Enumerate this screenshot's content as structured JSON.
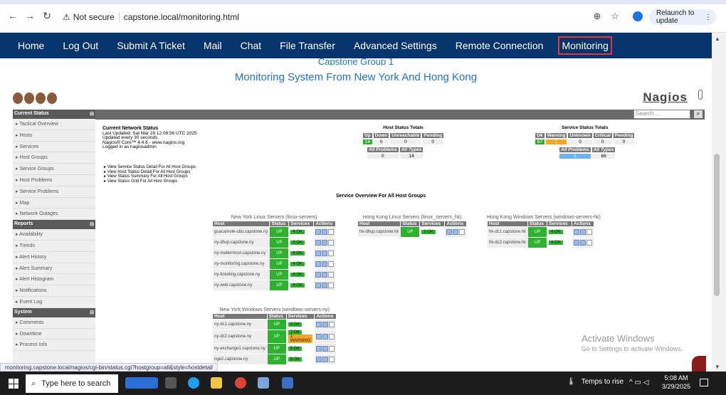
{
  "browser": {
    "not_secure": "Not secure",
    "url": "capstone.local/monitoring.html",
    "relaunch": "Relaunch to update",
    "status_url": "monitoring.capstone.local/nagios/cgi-bin/status.cgi?hostgroup=all&style=hostdetail"
  },
  "nav": [
    "Home",
    "Log Out",
    "Submit A Ticket",
    "Mail",
    "Chat",
    "File Transfer",
    "Advanced Settings",
    "Remote Connection",
    "Monitoring"
  ],
  "titles": {
    "t1": "Capstone Group 1",
    "t2": "Monitoring System From New York And Hong Kong"
  },
  "nagios": {
    "brand": "Nagios",
    "search_placeholder": "Search ...",
    "sidebar": {
      "current_status": "Current Status",
      "current_items": [
        "Tactical Overview",
        "Hosts",
        "Services",
        "Host Groups",
        "Service Groups",
        "Host Problems",
        "Service Problems",
        "Map",
        "Network Outages"
      ],
      "reports": "Reports",
      "report_items": [
        "Availability",
        "Trends",
        "Alert History",
        "Alert Summary",
        "Alert Histogram",
        "Notifications",
        "Event Log"
      ],
      "system": "System",
      "system_items": [
        "Comments",
        "Downtime",
        "Process Info"
      ]
    },
    "current": {
      "heading": "Current Network Status",
      "updated": "Last Updated: Sat Mar 29 12:08:56 UTC 2025",
      "every": "Updated every 30 seconds",
      "core": "Nagios® Core™ 4.4.6 - www.nagios.org",
      "logged": "Logged in as nagiosadmin"
    },
    "links": [
      "View Service Status Detail For All Host Groups",
      "View Host Status Detail For All Host Groups",
      "View Status Summary For All Host Groups",
      "View Status Grid For All Host Groups"
    ],
    "host_totals": {
      "title": "Host Status Totals",
      "headers": [
        "Up",
        "Down",
        "Unreachable",
        "Pending"
      ],
      "values": [
        "14",
        "0",
        "0",
        "0"
      ],
      "sub_headers": [
        "All Problems",
        "All Types"
      ],
      "sub_values": [
        "0",
        "14"
      ]
    },
    "service_totals": {
      "title": "Service Status Totals",
      "headers": [
        "Ok",
        "Warning",
        "Unknown",
        "Critical",
        "Pending"
      ],
      "values": [
        "67",
        "1",
        "0",
        "0",
        "0"
      ],
      "sub_headers": [
        "All Problems",
        "All Types"
      ],
      "sub_values": [
        "1",
        "68"
      ]
    },
    "overview_title": "Service Overview For All Host Groups",
    "table_headers": [
      "Host",
      "Status",
      "Services",
      "Actions"
    ],
    "groups": {
      "ny_linux": {
        "caption": "New York Linux Servers (linux-servers)",
        "rows": [
          {
            "host": "guacamole-ubu.capstone.ny",
            "status": "UP",
            "svc": "4 OK"
          },
          {
            "host": "ny-dhcp.capstone.ny",
            "status": "UP",
            "svc": "3 OK"
          },
          {
            "host": "ny-mattermost.capstone.ny",
            "status": "UP",
            "svc": "4 OK"
          },
          {
            "host": "ny-monitoring.capstone.ny",
            "status": "UP",
            "svc": "4 OK"
          },
          {
            "host": "ny-ticketing.capstone.ny",
            "status": "UP",
            "svc": "4 OK"
          },
          {
            "host": "ny-web.capstone.ny",
            "status": "UP",
            "svc": "4 OK"
          }
        ]
      },
      "hk_linux": {
        "caption": "Hong Kong Linux Servers (linux_servers_hk)",
        "rows": [
          {
            "host": "hk-dhcp.capstone.hk",
            "status": "UP",
            "svc": "3 OK"
          }
        ]
      },
      "hk_win": {
        "caption": "Hong Kong Windows Servers (windows-servers-hk)",
        "rows": [
          {
            "host": "hk-dc1.capstone.hk",
            "status": "UP",
            "svc": "4 OK"
          },
          {
            "host": "hk-dc2.capstone.hk",
            "status": "UP",
            "svc": "4 OK"
          }
        ]
      },
      "ny_win": {
        "caption": "New York Windows Servers (windows-servers-ny)",
        "rows": [
          {
            "host": "ny-dc1.capstone.ny",
            "status": "UP",
            "svc": "8 OK"
          },
          {
            "host": "ny-dc2.capstone.ny",
            "status": "UP",
            "svc": "7 OK",
            "svc2": "1 WARNING"
          },
          {
            "host": "ny-exchange1.capstone.ny",
            "status": "UP",
            "svc": "5 OK"
          },
          {
            "host": "nge2.capstone.ny",
            "status": "UP",
            "svc": "5 OK"
          }
        ]
      }
    }
  },
  "windows": {
    "activate": "Activate Windows",
    "goto": "Go to Settings to activate Windows."
  },
  "taskbar": {
    "search": "Type here to search",
    "weather": "Temps to rise",
    "time": "5:08 AM",
    "date": "3/29/2025"
  },
  "colors": {
    "nav_bg": "#06346b",
    "title_blue": "#1e73c9",
    "ok_green": "#2cb22c",
    "warning": "#f5a623"
  }
}
